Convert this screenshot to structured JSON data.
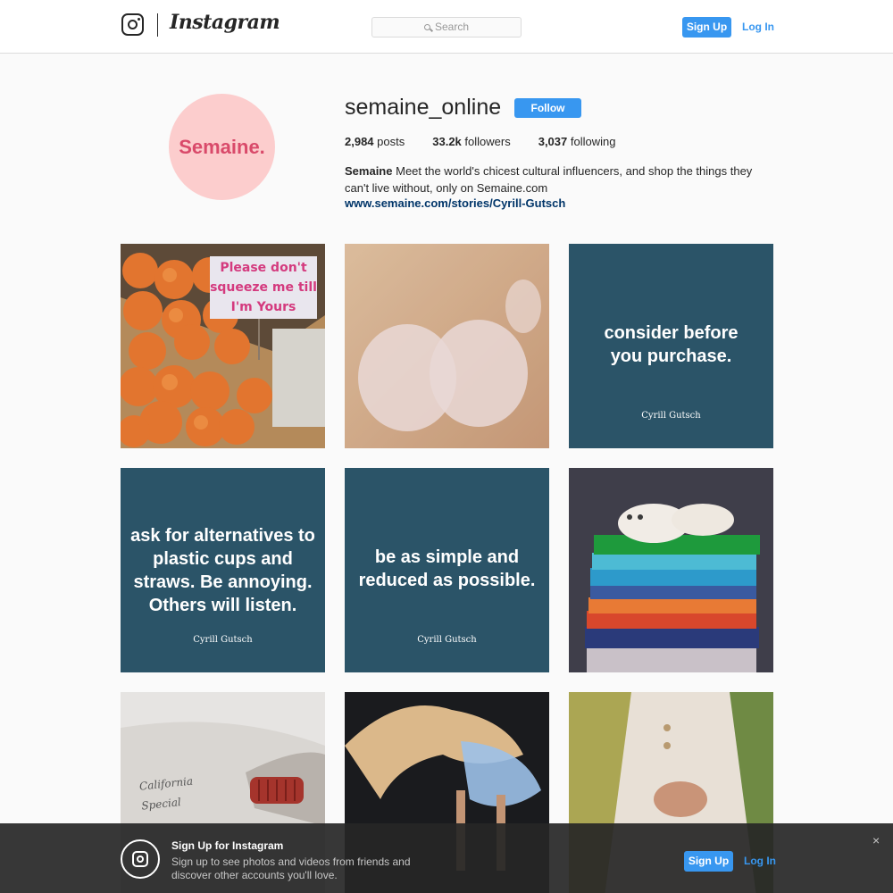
{
  "header": {
    "wordmark": "Instagram",
    "search_placeholder": "Search",
    "signup_label": "Sign Up",
    "login_label": "Log In"
  },
  "profile": {
    "avatar_text": "Semaine.",
    "username": "semaine_online",
    "follow_label": "Follow",
    "posts_count": "2,984",
    "posts_label": "posts",
    "followers_count": "33.2k",
    "followers_label": "followers",
    "following_count": "3,037",
    "following_label": "following",
    "bio_name": "Semaine",
    "bio_text": "Meet the world's chicest cultural influencers, and shop the things they can't live without, only on Semaine.com",
    "website": "www.semaine.com/stories/Cyrill-Gutsch"
  },
  "posts": {
    "tile3": {
      "text": "consider before you purchase.",
      "author": "Cyrill Gutsch"
    },
    "tile4": {
      "text": "ask for alternatives to plastic cups and straws. Be annoying. Others will listen.",
      "author": "Cyrill Gutsch"
    },
    "tile5": {
      "text": "be as simple and reduced as possible.",
      "author": "Cyrill Gutsch"
    },
    "tile1_sign": "Please don't squeeze me till I'm Yours",
    "tile7_script": "California Special"
  },
  "banner": {
    "title": "Sign Up for Instagram",
    "description": "Sign up to see photos and videos from friends and discover other accounts you'll love.",
    "signup_label": "Sign Up",
    "login_label": "Log In",
    "close_glyph": "×"
  },
  "colors": {
    "accent": "#3897f0",
    "quote_bg": "#2b5468",
    "avatar_bg": "#fccdcd",
    "avatar_text": "#d94a6a"
  }
}
